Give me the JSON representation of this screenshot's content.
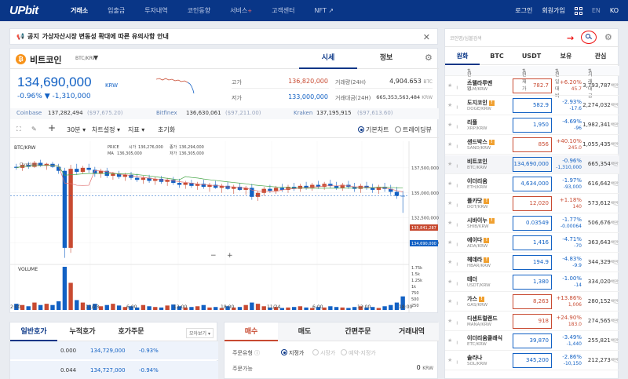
{
  "nav": {
    "logo": "UPbit",
    "items": [
      "거래소",
      "입출금",
      "투자내역",
      "코인동향",
      "서비스",
      "고객센터",
      "NFT"
    ],
    "service_plus": "+",
    "nft_arrow": "↗",
    "login": "로그인",
    "signup": "회원가입",
    "lang_en": "EN",
    "lang_ko": "KO"
  },
  "notice": {
    "prefix": "공지",
    "text": "가상자산시장 변동성 확대에 따른 유의사항 안내",
    "close": "✕"
  },
  "coin": {
    "icon": "₿",
    "name": "비트코인",
    "pair": "BTC/KRW",
    "tab_quote": "시세",
    "tab_info": "정보",
    "price": "134,690,000",
    "unit": "KRW",
    "change_pct": "-0.96%",
    "change_abs": "▼ -1,310,000",
    "high_label": "고가",
    "high_value": "136,820,000",
    "low_label": "저가",
    "low_value": "133,000,000",
    "vol_label": "거래량(24H)",
    "vol_value": "4,904.653",
    "vol_unit": "BTC",
    "amt_label": "거래대금(24H)",
    "amt_value": "665,353,563,484",
    "amt_unit": "KRW"
  },
  "exchanges": [
    {
      "name": "Coinbase",
      "value": "137,282,494",
      "sub": "($97,675.20)"
    },
    {
      "name": "Bitfinex",
      "value": "136,630,061",
      "sub": "($97,211.00)"
    },
    {
      "name": "Kraken",
      "value": "137,195,915",
      "sub": "($97,613.60)"
    }
  ],
  "toolbar": {
    "interval": "30분",
    "chart_settings": "차트설정",
    "indicator": "지표",
    "reset": "초기화",
    "basic_chart": "기본차트",
    "tradingview": "트레이딩뷰"
  },
  "chart": {
    "pair_label": "BTC/KRW",
    "overlay_label": "Overlays",
    "ohlc_labels": [
      "PRICE",
      "시가",
      "136,276,000",
      "종가",
      "136,294,000",
      "MA",
      "136,305,000",
      "저가",
      "136,305,000"
    ],
    "volume_label": "VOLUME",
    "price_ticks": [
      "137,500,000",
      "135,000,000",
      "132,500,000",
      "130,000,000"
    ],
    "price_tag_red": "135,841,287",
    "price_tag_blue": "134,690,000",
    "vol_ticks": [
      "1.75k",
      "1.5k",
      "1.25k",
      "1k",
      "750",
      "500",
      "250"
    ],
    "time_ticks": [
      "2:00",
      "11/23",
      "6:00",
      "12:00",
      "18:00",
      "11/24",
      "6:00",
      "12:00",
      "18:00"
    ],
    "zoom_minus": "−",
    "zoom_plus": "+"
  },
  "chart_data": {
    "type": "candlestick",
    "ylim": [
      128000000,
      140000000
    ],
    "candles": [
      [
        137600000,
        137900000,
        137300000,
        137500000
      ],
      [
        137500000,
        138000000,
        137200000,
        137800000
      ],
      [
        137800000,
        138100000,
        137400000,
        137600000
      ],
      [
        137600000,
        138200000,
        137500000,
        138000000
      ],
      [
        138000000,
        138300000,
        137600000,
        137700000
      ],
      [
        137700000,
        138000000,
        137300000,
        137900000
      ],
      [
        137900000,
        138100000,
        137500000,
        137600000
      ],
      [
        137600000,
        137900000,
        136900000,
        137200000
      ],
      [
        137200000,
        137500000,
        128500000,
        129500000
      ],
      [
        129500000,
        137800000,
        129000000,
        137400000
      ],
      [
        137400000,
        137900000,
        136800000,
        137100000
      ],
      [
        137100000,
        137700000,
        136900000,
        137500000
      ],
      [
        137500000,
        137900000,
        137000000,
        137300000
      ],
      [
        137300000,
        137600000,
        136600000,
        136900000
      ],
      [
        136900000,
        137400000,
        136500000,
        137200000
      ],
      [
        137200000,
        137500000,
        136500000,
        136700000
      ],
      [
        136700000,
        137100000,
        136300000,
        136900000
      ],
      [
        136900000,
        137200000,
        136400000,
        136600000
      ],
      [
        136600000,
        137000000,
        136200000,
        136800000
      ],
      [
        136800000,
        137100000,
        136300000,
        136500000
      ],
      [
        136500000,
        136900000,
        136100000,
        136300000
      ],
      [
        136300000,
        136700000,
        135900000,
        136500000
      ],
      [
        136500000,
        136800000,
        136000000,
        136200000
      ],
      [
        136200000,
        136600000,
        135800000,
        136400000
      ],
      [
        136400000,
        136700000,
        135900000,
        136100000
      ],
      [
        136100000,
        136500000,
        135700000,
        136300000
      ],
      [
        136300000,
        136600000,
        135800000,
        136000000
      ],
      [
        136000000,
        136400000,
        135500000,
        135800000
      ],
      [
        135800000,
        136200000,
        135400000,
        136000000
      ],
      [
        136000000,
        136300000,
        135500000,
        135700000
      ],
      [
        135700000,
        136100000,
        135300000,
        135900000
      ],
      [
        135900000,
        136300000,
        135400000,
        135600000
      ],
      [
        135600000,
        136000000,
        135100000,
        135800000
      ],
      [
        135800000,
        136200000,
        135400000,
        135500000
      ],
      [
        135500000,
        135900000,
        135000000,
        135700000
      ],
      [
        135700000,
        136100000,
        135300000,
        135400000
      ],
      [
        135400000,
        135800000,
        134900000,
        135600000
      ],
      [
        135600000,
        136000000,
        135200000,
        135300000
      ],
      [
        135300000,
        135700000,
        134800000,
        135500000
      ],
      [
        135500000,
        135900000,
        134300000,
        134600000
      ],
      [
        134600000,
        135200000,
        134200000,
        135000000
      ],
      [
        135000000,
        135600000,
        134700000,
        135400000
      ],
      [
        135400000,
        135800000,
        135000000,
        135200000
      ],
      [
        135200000,
        135700000,
        134900000,
        135500000
      ],
      [
        135500000,
        135900000,
        135100000,
        135300000
      ],
      [
        135300000,
        135800000,
        135000000,
        135600000
      ],
      [
        135600000,
        136000000,
        135200000,
        135400000
      ],
      [
        135400000,
        135900000,
        135100000,
        135700000
      ],
      [
        135700000,
        136100000,
        135300000,
        135500000
      ],
      [
        135500000,
        136000000,
        135200000,
        135800000
      ],
      [
        135800000,
        136200000,
        135400000,
        135600000
      ],
      [
        135600000,
        136100000,
        135300000,
        135900000
      ],
      [
        135900000,
        136300000,
        135500000,
        135700000
      ],
      [
        135700000,
        136100000,
        135300000,
        135500000
      ],
      [
        135500000,
        136000000,
        135200000,
        135800000
      ],
      [
        135800000,
        136200000,
        135400000,
        135600000
      ],
      [
        135600000,
        136000000,
        135100000,
        135400000
      ],
      [
        135400000,
        135900000,
        135000000,
        135700000
      ],
      [
        135700000,
        136100000,
        135300000,
        135500000
      ],
      [
        135500000,
        135900000,
        135000000,
        135300000
      ],
      [
        135300000,
        135800000,
        134900000,
        135600000
      ],
      [
        135600000,
        136000000,
        135100000,
        135400000
      ],
      [
        135400000,
        135800000,
        134800000,
        135100000
      ],
      [
        135100000,
        135600000,
        134400000,
        134700000
      ],
      [
        134700000,
        135200000,
        133000000,
        134690000
      ]
    ],
    "volumes": [
      0.25,
      0.2,
      0.15,
      0.3,
      0.2,
      0.25,
      0.2,
      0.35,
      1.75,
      1.1,
      0.4,
      0.3,
      0.2,
      0.25,
      0.15,
      0.2,
      0.25,
      0.18,
      0.12,
      0.15,
      0.1,
      0.2,
      0.15,
      0.12,
      0.1,
      0.18,
      0.22,
      0.15,
      0.1,
      0.12,
      0.15,
      0.2,
      0.1,
      0.12,
      0.08,
      0.15,
      0.1,
      0.12,
      0.2,
      0.3,
      0.25,
      0.15,
      0.1,
      0.12,
      0.08,
      0.1,
      0.12,
      0.15,
      0.1,
      0.08,
      0.12,
      0.1,
      0.15,
      0.12,
      0.1,
      0.08,
      0.12,
      0.15,
      0.1,
      0.12,
      0.08,
      0.15,
      0.2,
      0.3,
      0.55
    ]
  },
  "orderbook": {
    "tabs": [
      "일반호가",
      "누적호가",
      "호가주문"
    ],
    "select": "모아보기 ▾",
    "rows": [
      {
        "qty": "0.000",
        "price": "134,729,000",
        "pct": "-0.93%"
      },
      {
        "qty": "0.044",
        "price": "134,727,000",
        "pct": "-0.94%"
      }
    ]
  },
  "order": {
    "tabs": [
      "매수",
      "매도",
      "간편주문",
      "거래내역"
    ],
    "type_label": "주문유형",
    "type_info": "ⓘ",
    "opt_limit": "지정가",
    "opt_market": "시장가",
    "opt_reserve": "예약-지정가",
    "avail_label": "주문가능",
    "avail_value": "0",
    "avail_unit": "KRW"
  },
  "market": {
    "search_placeholder": "코인명/심볼검색",
    "tabs": [
      "원화",
      "BTC",
      "USDT",
      "보유",
      "관심"
    ],
    "headers": [
      "한글명",
      "현재가",
      "전일대비",
      "거래대금"
    ],
    "vol_unit": "백만",
    "rows": [
      {
        "name": "스텔라루멘",
        "pair": "XLM/KRW",
        "price": "782.7",
        "pct": "+6.20%",
        "abs": "45.7",
        "vol": "3,793,787",
        "up": true,
        "badge": ""
      },
      {
        "name": "도지코인",
        "pair": "DOGE/KRW",
        "price": "582.9",
        "pct": "-2.93%",
        "abs": "-17.6",
        "vol": "2,274,032",
        "up": false,
        "badge": "!"
      },
      {
        "name": "리플",
        "pair": "XRP/KRW",
        "price": "1,950",
        "pct": "-4.69%",
        "abs": "-96",
        "vol": "1,982,341",
        "up": false,
        "badge": ""
      },
      {
        "name": "샌드박스",
        "pair": "SAND/KRW",
        "price": "856",
        "pct": "+40.10%",
        "abs": "245.0",
        "vol": "1,055,435",
        "up": true,
        "badge": "!"
      },
      {
        "name": "비트코인",
        "pair": "BTC/KRW",
        "price": "134,690,000",
        "pct": "-0.96%",
        "abs": "-1,310,000",
        "vol": "665,354",
        "up": false,
        "badge": ""
      },
      {
        "name": "이더리움",
        "pair": "ETH/KRW",
        "price": "4,634,000",
        "pct": "-1.97%",
        "abs": "-93,000",
        "vol": "616,642",
        "up": false,
        "badge": ""
      },
      {
        "name": "폴카닷",
        "pair": "DOT/KRW",
        "price": "12,020",
        "pct": "+1.18%",
        "abs": "140",
        "vol": "573,612",
        "up": true,
        "badge": "!"
      },
      {
        "name": "시바이누",
        "pair": "SHIB/KRW",
        "price": "0.03549",
        "pct": "-1.77%",
        "abs": "-0.00064",
        "vol": "506,676",
        "up": false,
        "badge": "!"
      },
      {
        "name": "에이다",
        "pair": "ADA/KRW",
        "price": "1,416",
        "pct": "-4.71%",
        "abs": "-70",
        "vol": "363,643",
        "up": false,
        "badge": "!"
      },
      {
        "name": "헤데라",
        "pair": "HBAR/KRW",
        "price": "194.9",
        "pct": "-4.83%",
        "abs": "-9.9",
        "vol": "344,329",
        "up": false,
        "badge": "!"
      },
      {
        "name": "테더",
        "pair": "USDT/KRW",
        "price": "1,380",
        "pct": "-1.00%",
        "abs": "-14",
        "vol": "334,020",
        "up": false,
        "badge": ""
      },
      {
        "name": "가스",
        "pair": "GAS/KRW",
        "price": "8,263",
        "pct": "+13.86%",
        "abs": "1,006",
        "vol": "280,152",
        "up": true,
        "badge": "!"
      },
      {
        "name": "디센트럴랜드",
        "pair": "MANA/KRW",
        "price": "918",
        "pct": "+24.90%",
        "abs": "183.0",
        "vol": "274,565",
        "up": true,
        "badge": ""
      },
      {
        "name": "이더리움클래식",
        "pair": "ETC/KRW",
        "price": "39,870",
        "pct": "-3.49%",
        "abs": "-1,440",
        "vol": "255,821",
        "up": false,
        "badge": ""
      },
      {
        "name": "솔라나",
        "pair": "SOL/KRW",
        "price": "345,200",
        "pct": "-2.86%",
        "abs": "-10,150",
        "vol": "212,273",
        "up": false,
        "badge": ""
      }
    ]
  },
  "colors": {
    "up": "#c84a31",
    "down": "#1261c4",
    "brand": "#093687"
  }
}
